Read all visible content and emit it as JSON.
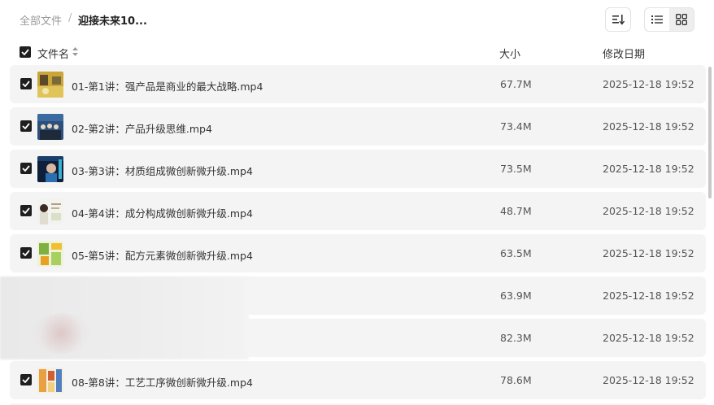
{
  "breadcrumb": {
    "root": "全部文件",
    "separator": "/",
    "current": "迎接未来10..."
  },
  "columns": {
    "name": "文件名",
    "size": "大小",
    "date": "修改日期"
  },
  "files": [
    {
      "name": "01-第1讲：强产品是商业的最大战略.mp4",
      "size": "67.7M",
      "date": "2025-12-18 19:52",
      "checked": true
    },
    {
      "name": "02-第2讲：产品升级思维.mp4",
      "size": "73.4M",
      "date": "2025-12-18 19:52",
      "checked": true
    },
    {
      "name": "03-第3讲：材质组成微创新微升级.mp4",
      "size": "73.5M",
      "date": "2025-12-18 19:52",
      "checked": true
    },
    {
      "name": "04-第4讲：成分构成微创新微升级.mp4",
      "size": "48.7M",
      "date": "2025-12-18 19:52",
      "checked": true
    },
    {
      "name": "05-第5讲：配方元素微创新微升级.mp4",
      "size": "63.5M",
      "date": "2025-12-18 19:52",
      "checked": true
    },
    {
      "name": "",
      "size": "63.9M",
      "date": "2025-12-18 19:52",
      "checked": true
    },
    {
      "name": "",
      "size": "82.3M",
      "date": "2025-12-18 19:52",
      "checked": true
    },
    {
      "name": "08-第8讲：工艺工序微创新微升级.mp4",
      "size": "78.6M",
      "date": "2025-12-18 19:52",
      "checked": true
    }
  ],
  "colors": {
    "row_bg": "#f4f4f4",
    "checkbox": "#1f1f1f",
    "muted_text": "#9a9a9a"
  },
  "icons": {
    "sort": "sort-lines-icon",
    "list_view": "list-view-icon",
    "grid_view": "grid-view-icon",
    "header_sort": "sort-arrows-icon"
  }
}
